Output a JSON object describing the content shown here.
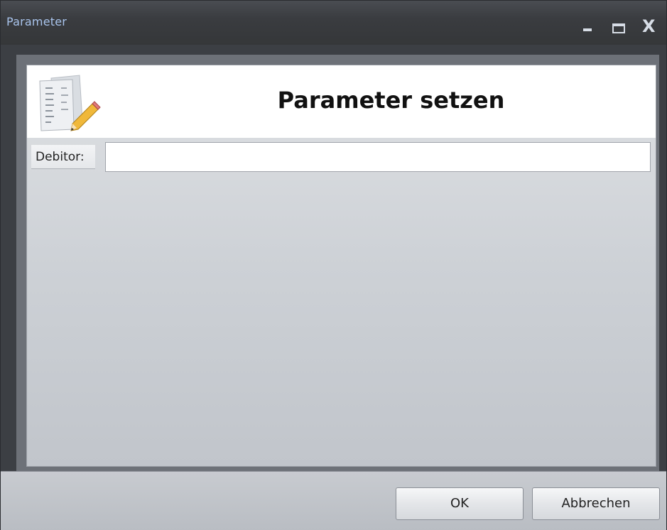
{
  "window": {
    "title": "Parameter",
    "controls": {
      "minimize_icon": "minimize-icon",
      "maximize_icon": "maximize-icon",
      "close_label": "X"
    }
  },
  "header": {
    "title": "Parameter setzen",
    "icon": "document-edit-icon"
  },
  "form": {
    "fields": [
      {
        "label": "Debitor:",
        "value": "",
        "placeholder": ""
      }
    ]
  },
  "footer": {
    "ok_label": "OK",
    "cancel_label": "Abbrechen"
  },
  "colors": {
    "titlebar": "#3a3c40",
    "title_text": "#a9c4ec",
    "content_bg": "#cdd1d6"
  }
}
